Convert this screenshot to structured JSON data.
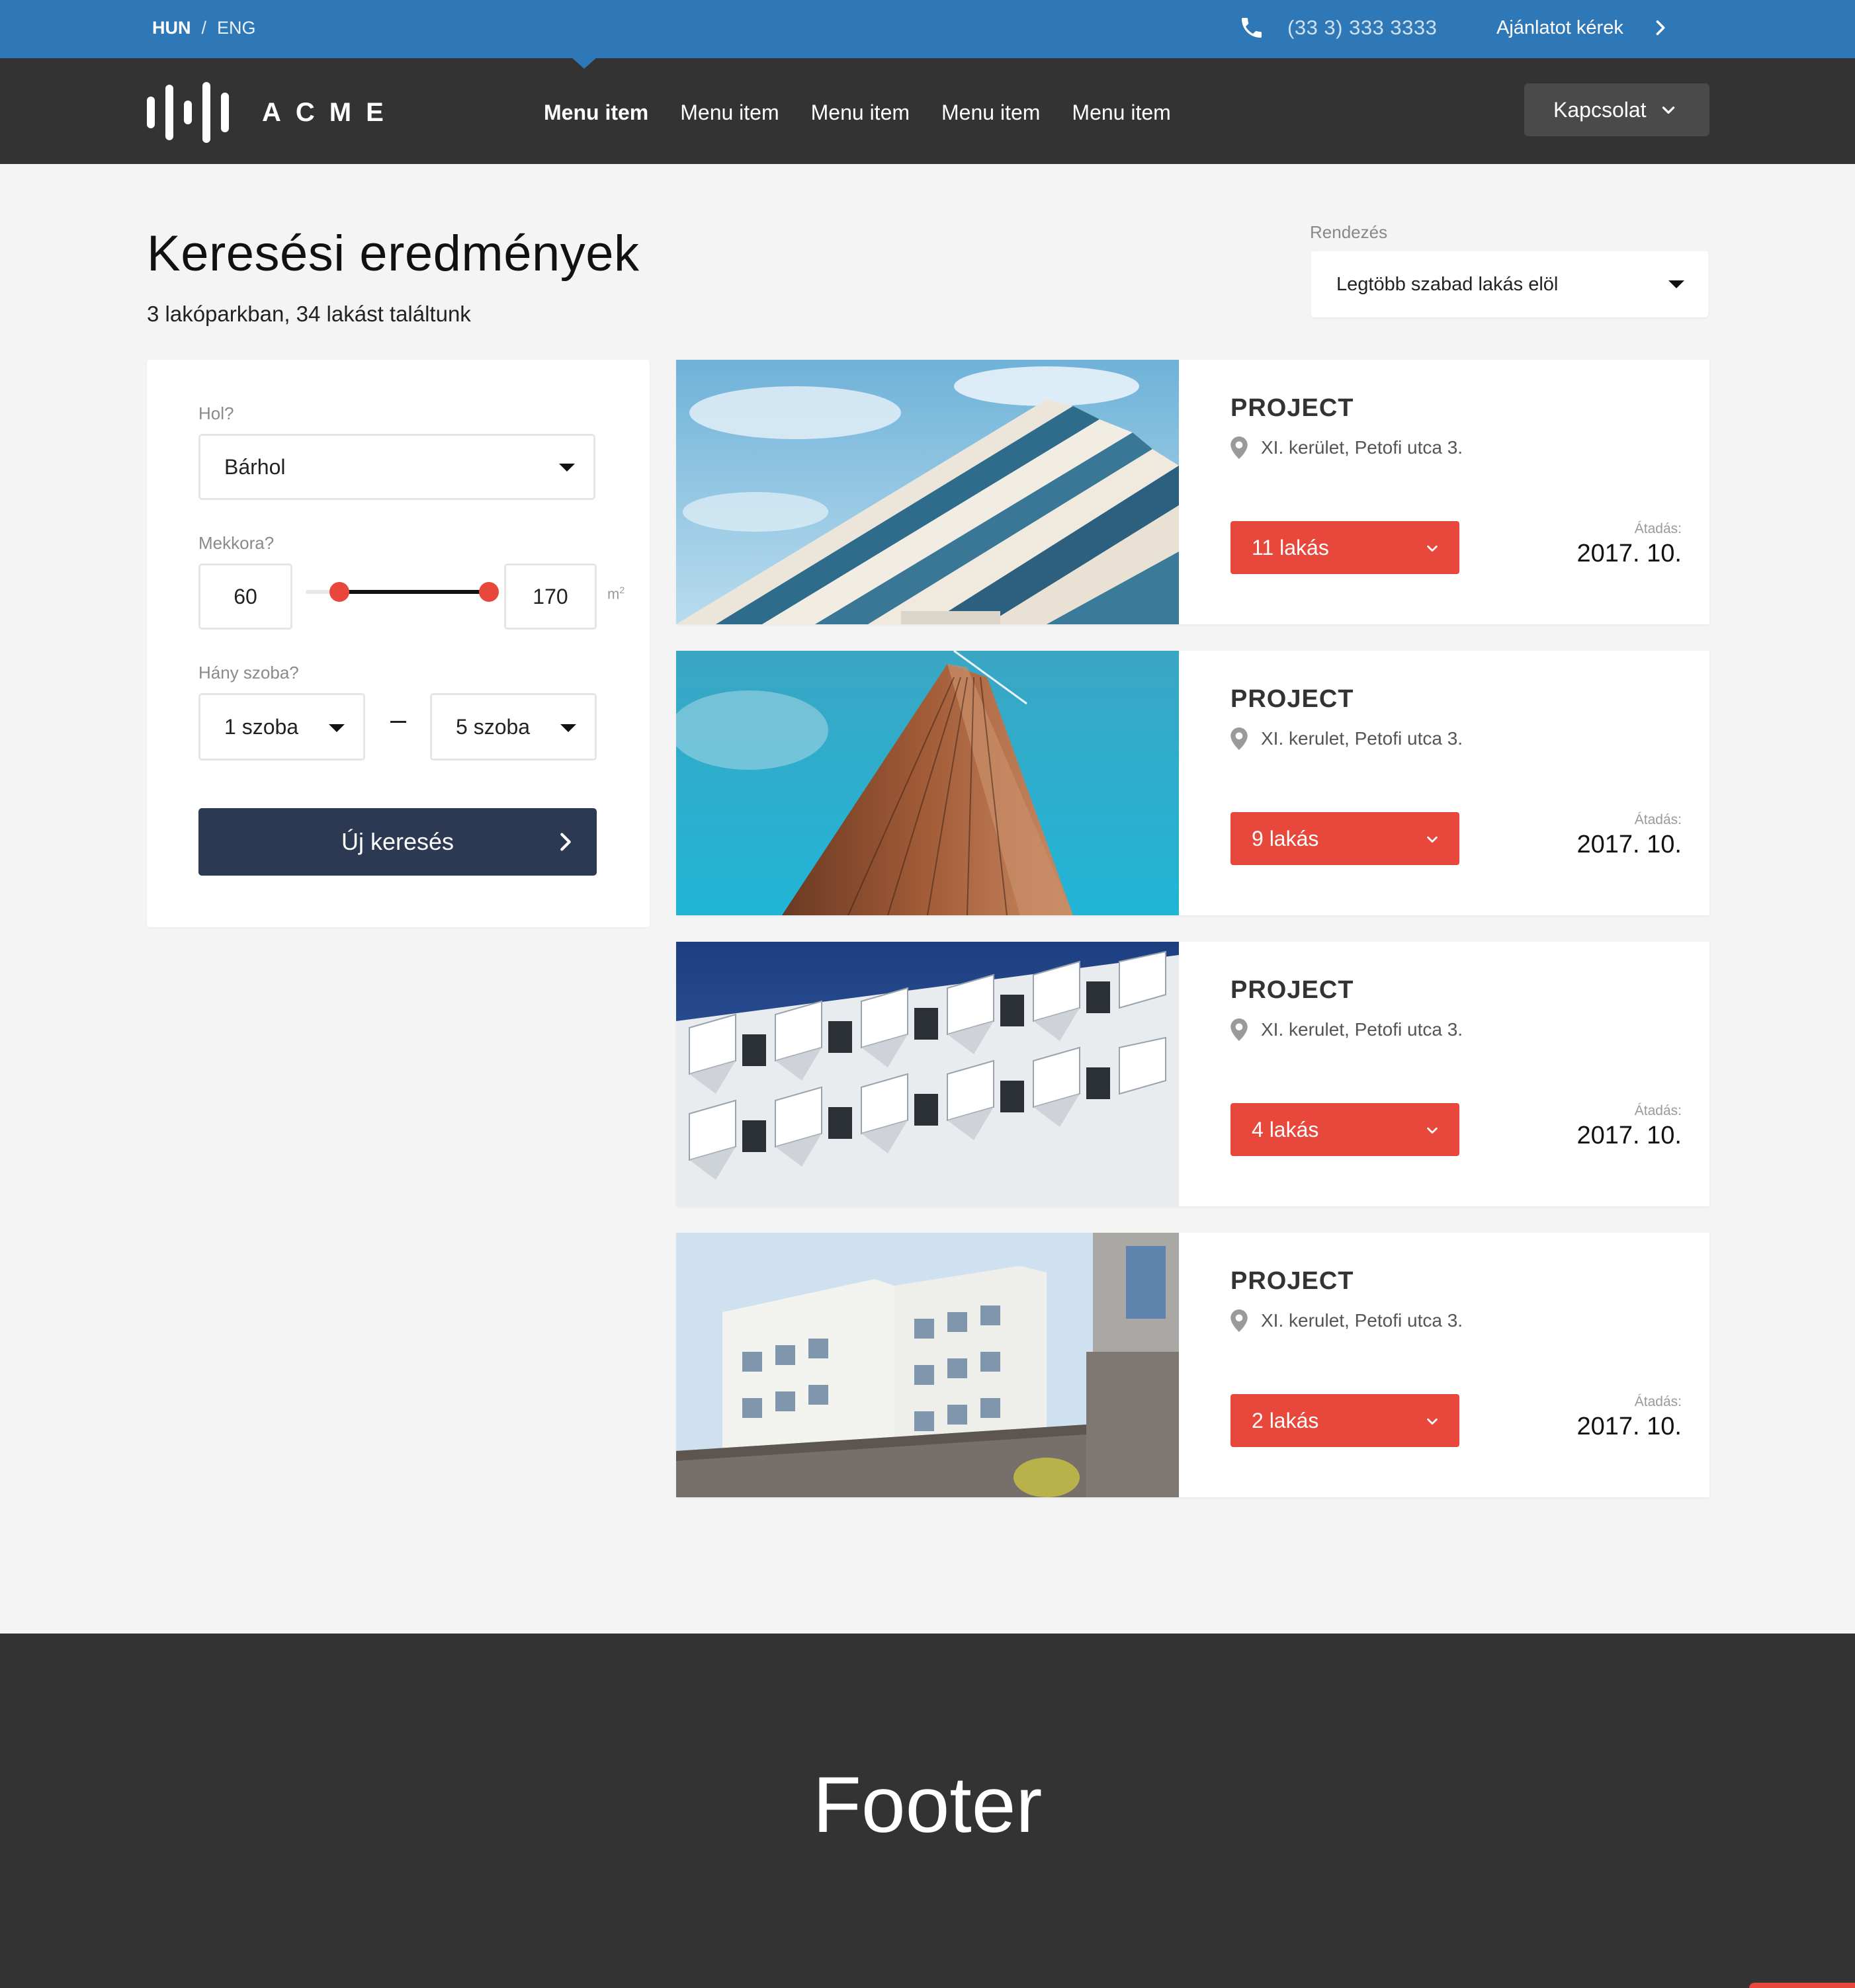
{
  "topbar": {
    "lang_active": "HUN",
    "lang_separator": "/",
    "lang_other": "ENG",
    "phone": "(33 3) 333 3333",
    "offer_label": "Ajánlatot kérek"
  },
  "nav": {
    "brand": "ACME",
    "menu": [
      {
        "label": "Menu item",
        "active": true
      },
      {
        "label": "Menu item",
        "active": false
      },
      {
        "label": "Menu item",
        "active": false
      },
      {
        "label": "Menu item",
        "active": false
      },
      {
        "label": "Menu item",
        "active": false
      }
    ],
    "contact_label": "Kapcsolat"
  },
  "page": {
    "title": "Keresési eredmények",
    "subtitle": "3 lakóparkban, 34 lakást találtunk"
  },
  "sort": {
    "label": "Rendezés",
    "value": "Legtöbb szabad lakás elöl"
  },
  "filter": {
    "where_label": "Hol?",
    "where_value": "Bárhol",
    "size_label": "Mekkora?",
    "size_min": "60",
    "size_max": "170",
    "size_unit": "m",
    "size_unit_exp": "2",
    "slider_min_fraction": 0.18,
    "slider_max_fraction": 0.97,
    "rooms_label": "Hány szoba?",
    "rooms_min": "1 szoba",
    "rooms_max": "5 szoba",
    "search_button": "Új keresés"
  },
  "results": [
    {
      "title": "PROJECT",
      "address": "XI. kerület, Petofi utca 3.",
      "units": "11 lakás",
      "delivery_label": "Átadás:",
      "delivery_date": "2017. 10."
    },
    {
      "title": "PROJECT",
      "address": "XI. kerulet, Petofi utca 3.",
      "units": "9 lakás",
      "delivery_label": "Átadás:",
      "delivery_date": "2017. 10."
    },
    {
      "title": "PROJECT",
      "address": "XI. kerulet, Petofi utca 3.",
      "units": "4 lakás",
      "delivery_label": "Átadás:",
      "delivery_date": "2017. 10."
    },
    {
      "title": "PROJECT",
      "address": "XI. kerulet, Petofi utca 3.",
      "units": "2 lakás",
      "delivery_label": "Átadás:",
      "delivery_date": "2017. 10."
    }
  ],
  "footer": {
    "text": "Footer"
  },
  "icons": {
    "phone": "phone-icon",
    "chevron_right": "chevron-right-icon",
    "chevron_down": "chevron-down-icon",
    "caret_down": "caret-down-icon",
    "location": "location-pin-icon",
    "logo": "acme-logo-icon"
  },
  "colors": {
    "topbar_blue": "#2f78b7",
    "nav_dark": "#333333",
    "accent_red": "#e8473b",
    "search_button_navy": "#2b3a52",
    "page_bg": "#f4f4f4"
  }
}
